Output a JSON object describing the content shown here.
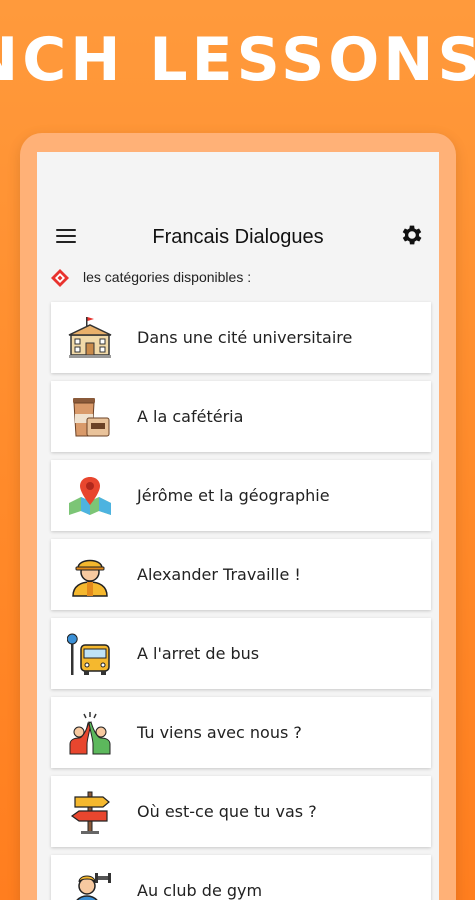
{
  "banner": {
    "text": "NCH LESSONS"
  },
  "appbar": {
    "title": "Francais Dialogues",
    "menu_icon": "hamburger-menu-icon",
    "settings_icon": "gear-icon"
  },
  "section": {
    "label": "les catégories disponibles :",
    "icon": "category-diamond-icon"
  },
  "categories": [
    {
      "label": "Dans une cité universitaire",
      "icon": "university-building-icon"
    },
    {
      "label": "A la cafétéria",
      "icon": "coffee-cup-icon"
    },
    {
      "label": "Jérôme et la géographie",
      "icon": "map-pin-icon"
    },
    {
      "label": "Alexander Travaille !",
      "icon": "construction-worker-icon"
    },
    {
      "label": "A l'arret de bus",
      "icon": "bus-stop-icon"
    },
    {
      "label": "Tu viens avec nous ?",
      "icon": "friends-high-five-icon"
    },
    {
      "label": "Où est-ce que tu vas ?",
      "icon": "direction-signpost-icon"
    },
    {
      "label": "Au club de gym",
      "icon": "gym-person-icon"
    }
  ],
  "colors": {
    "background": "#ff8a2a",
    "frame": "#ffb177",
    "screen": "#f4f4f4",
    "card": "#ffffff",
    "accent_red": "#e8322e"
  }
}
